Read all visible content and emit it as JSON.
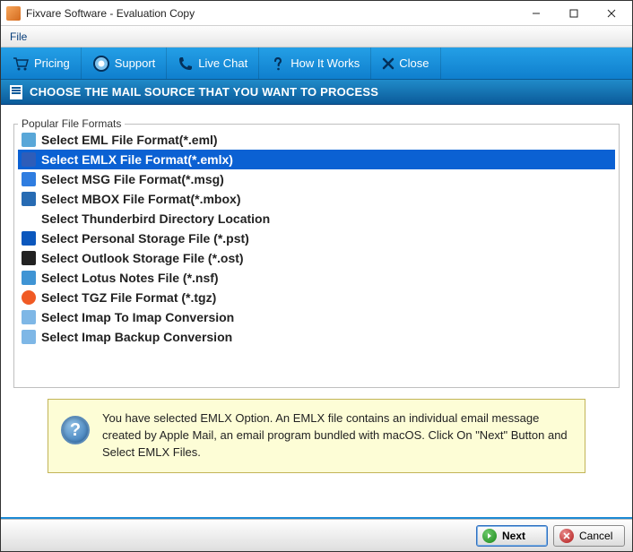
{
  "titlebar": {
    "title": "Fixvare Software - Evaluation Copy"
  },
  "menubar": {
    "items": [
      "File"
    ]
  },
  "toolbar": {
    "items": [
      {
        "label": "Pricing",
        "icon": "cart-icon"
      },
      {
        "label": "Support",
        "icon": "support-icon"
      },
      {
        "label": "Live Chat",
        "icon": "phone-icon"
      },
      {
        "label": "How It Works",
        "icon": "question-icon"
      },
      {
        "label": "Close",
        "icon": "close-x-icon"
      }
    ]
  },
  "banner": {
    "text": "CHOOSE THE MAIL SOURCE THAT YOU WANT TO PROCESS"
  },
  "formats": {
    "legend": "Popular File Formats",
    "items": [
      {
        "label": "Select EML File Format(*.eml)",
        "icon": "ico-eml",
        "selected": false
      },
      {
        "label": "Select EMLX File Format(*.emlx)",
        "icon": "ico-emlx",
        "selected": true
      },
      {
        "label": "Select MSG File Format(*.msg)",
        "icon": "ico-msg",
        "selected": false
      },
      {
        "label": "Select MBOX File Format(*.mbox)",
        "icon": "ico-mbox",
        "selected": false
      },
      {
        "label": "Select Thunderbird Directory Location",
        "icon": "ico-tbird",
        "selected": false
      },
      {
        "label": "Select Personal Storage File (*.pst)",
        "icon": "ico-pst",
        "selected": false
      },
      {
        "label": "Select Outlook Storage File (*.ost)",
        "icon": "ico-ost",
        "selected": false
      },
      {
        "label": "Select Lotus Notes File (*.nsf)",
        "icon": "ico-nsf",
        "selected": false
      },
      {
        "label": "Select TGZ File Format (*.tgz)",
        "icon": "ico-tgz",
        "selected": false
      },
      {
        "label": "Select Imap To Imap Conversion",
        "icon": "ico-imap",
        "selected": false
      },
      {
        "label": "Select Imap Backup Conversion",
        "icon": "ico-imapb",
        "selected": false
      }
    ]
  },
  "hint": {
    "text": "You have selected EMLX Option. An EMLX file contains an individual email message created by Apple Mail, an email program bundled with macOS. Click On \"Next\" Button and Select EMLX Files."
  },
  "footer": {
    "next": "Next",
    "cancel": "Cancel"
  }
}
